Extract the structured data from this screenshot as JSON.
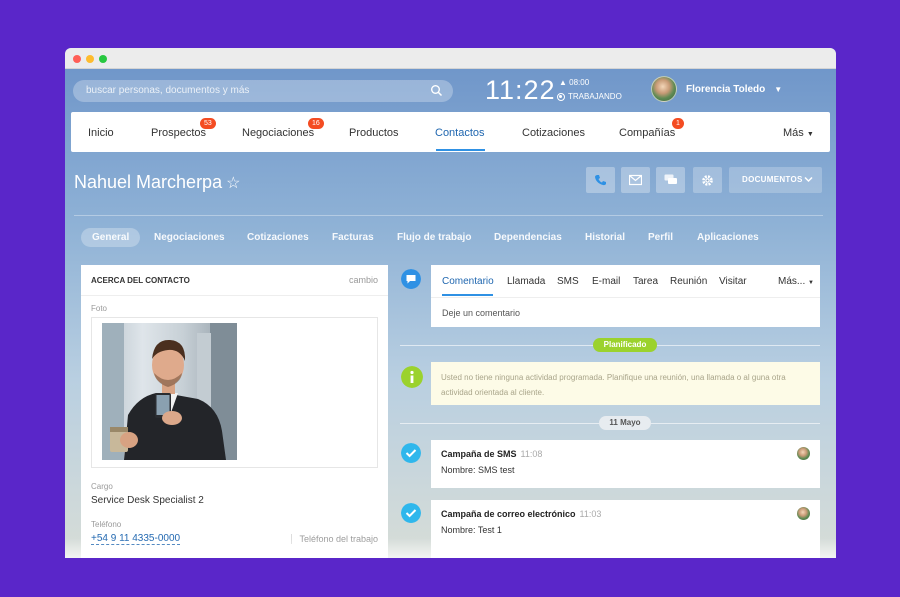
{
  "search": {
    "placeholder": "buscar personas, documentos y más"
  },
  "clock": {
    "time": "11:22",
    "alarm": "08:00",
    "status": "TRABAJANDO"
  },
  "user": {
    "name": "Florencia Toledo"
  },
  "nav": {
    "items": [
      {
        "label": "Inicio"
      },
      {
        "label": "Prospectos",
        "badge": "53"
      },
      {
        "label": "Negociaciones",
        "badge": "16"
      },
      {
        "label": "Productos"
      },
      {
        "label": "Contactos"
      },
      {
        "label": "Cotizaciones"
      },
      {
        "label": "Compañías",
        "badge": "1"
      },
      {
        "label": "Más"
      }
    ]
  },
  "contact": {
    "name": "Nahuel Marcherpa"
  },
  "toolbar": {
    "documents_label": "DOCUMENTOS"
  },
  "subtabs": [
    "General",
    "Negociaciones",
    "Cotizaciones",
    "Facturas",
    "Flujo de trabajo",
    "Dependencias",
    "Historial",
    "Perfil",
    "Aplicaciones"
  ],
  "about": {
    "header": "ACERCA DEL CONTACTO",
    "change": "cambio",
    "photo_label": "Foto",
    "position_label": "Cargo",
    "position_value": "Service Desk Specialist 2",
    "phone_label": "Teléfono",
    "phone_value": "+54 9 11 4335-0000",
    "phone_type": "Teléfono del trabajo"
  },
  "composer": {
    "tabs": [
      "Comentario",
      "Llamada",
      "SMS",
      "E-mail",
      "Tarea",
      "Reunión",
      "Visitar",
      "Más..."
    ],
    "placeholder": "Deje un comentario"
  },
  "timeline": {
    "planned_label": "Planificado",
    "notice": "Usted no tiene ninguna actividad programada. Planifique una reunión, una llamada o al guna otra actividad orientada al cliente.",
    "date_label": "11 Mayo",
    "cards": [
      {
        "title": "Campaña de SMS",
        "time": "11:08",
        "body": "Nombre: SMS test"
      },
      {
        "title": "Campaña de correo electrónico",
        "time": "11:03",
        "body": "Nombre: Test 1"
      }
    ]
  },
  "colors": {
    "accent": "#2f91e4",
    "badge": "#f44c22",
    "planned": "#9bd22d",
    "background": "#5a26c9"
  }
}
